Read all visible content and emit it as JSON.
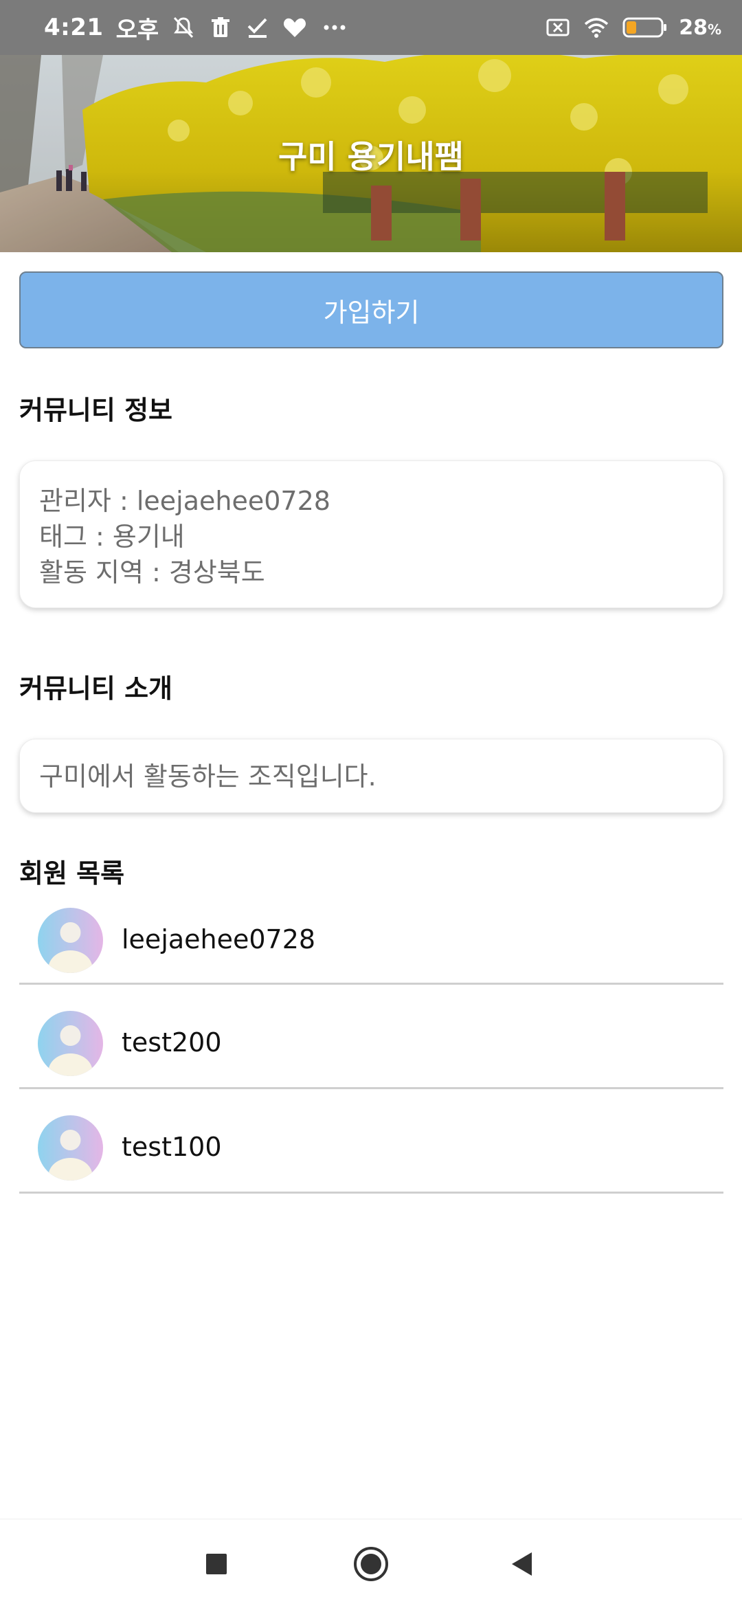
{
  "status_bar": {
    "time": "4:21",
    "ampm": "오후",
    "battery_percent": "28",
    "battery_unit": "%",
    "icons": [
      "notifications-off-icon",
      "trash-icon",
      "check-icon",
      "heart-icon",
      "more-icon",
      "sim-off-icon",
      "wifi-icon",
      "battery-icon"
    ]
  },
  "header": {
    "title": "구미 용기내팸"
  },
  "join_button": {
    "label": "가입하기"
  },
  "community_info": {
    "heading": "커뮤니티 정보",
    "lines": [
      "관리자 : leejaehee0728",
      "태그 : 용기내",
      "활동 지역 : 경상북도"
    ]
  },
  "community_intro": {
    "heading": "커뮤니티 소개",
    "text": "구미에서 활동하는 조직입니다."
  },
  "members": {
    "heading": "회원 목록",
    "items": [
      {
        "name": "leejaehee0728"
      },
      {
        "name": "test200"
      },
      {
        "name": "test100"
      }
    ]
  },
  "nav_bar": {
    "buttons": [
      "recents-square-icon",
      "home-circle-icon",
      "back-triangle-icon"
    ]
  },
  "colors": {
    "status_bar": "#7b7b7b",
    "join_button": "#7cb3ea",
    "divider": "#cfcfcf",
    "muted_text": "#6d6d6d"
  }
}
